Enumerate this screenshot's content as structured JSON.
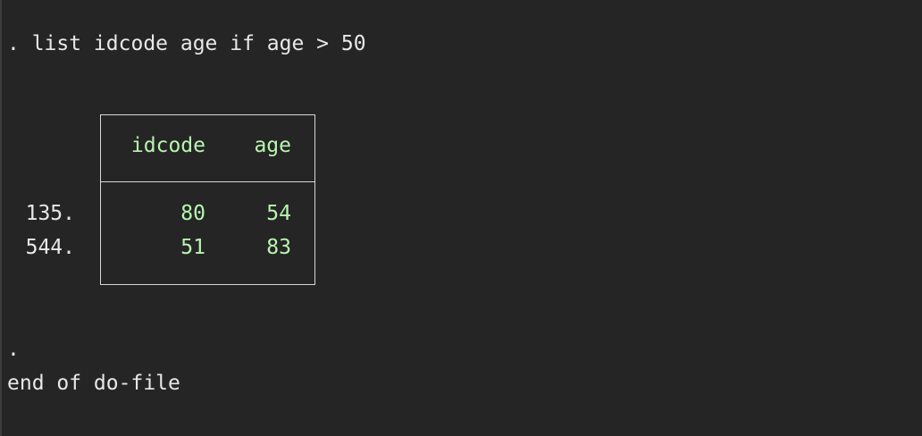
{
  "console": {
    "command": ". list idcode age if age > 50",
    "table": {
      "columns": [
        "idcode",
        "age"
      ],
      "rows": [
        {
          "obs": "135.",
          "idcode": "80",
          "age": "54"
        },
        {
          "obs": "544.",
          "idcode": "51",
          "age": "83"
        }
      ]
    },
    "prompt": ".",
    "end_message": "end of do-file"
  },
  "colors": {
    "background": "#252525",
    "text": "#e8e8e8",
    "result": "#b8f5b0",
    "border": "#d8d8d8"
  }
}
